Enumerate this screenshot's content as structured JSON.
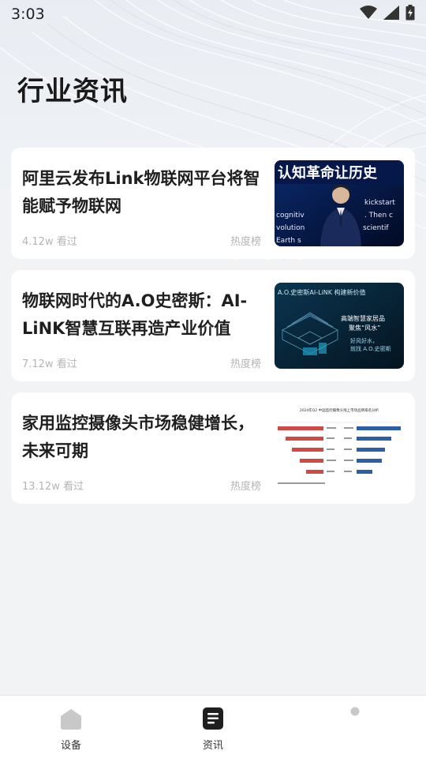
{
  "status_bar": {
    "time": "3:03",
    "icons": [
      "wifi-icon",
      "signal-icon",
      "battery-charging-icon"
    ]
  },
  "page": {
    "title": "行业资讯"
  },
  "news": [
    {
      "title": "阿里云发布Link物联网平台将智能赋予物联网",
      "views": "4.12w 看过",
      "tag": "热度榜",
      "thumb_text": [
        "认知革命让历史",
        "kickstart",
        "cognitiv",
        "volution",
        ". Then c",
        "Earth s",
        "scientif"
      ]
    },
    {
      "title": "物联网时代的A.O史密斯：AI-LiNK智慧互联再造产业价值",
      "views": "7.12w 看过",
      "tag": "热度榜",
      "thumb_text": [
        "A.O.史密斯AI-LiNK 构建新价值",
        "高端智慧家居品",
        "聚焦“风水”",
        "好风好水，",
        "就找 A.O.史密斯"
      ]
    },
    {
      "title": "家用监控摄像头市场稳健增长，未来可期",
      "views": "13.12w 看过",
      "tag": "热度榜",
      "thumb_text": [
        "2024年Q2 中国监控摄像头线上市场品牌排名分析"
      ]
    }
  ],
  "bottom_nav": {
    "items": [
      {
        "label": "设备",
        "icon": "home-icon",
        "active": false
      },
      {
        "label": "资讯",
        "icon": "document-icon",
        "active": true
      },
      {
        "label": "",
        "icon": "dot-icon",
        "active": false
      }
    ]
  },
  "colors": {
    "background": "#f2f3f5",
    "card": "#ffffff",
    "muted_text": "#b5b5b5",
    "active_icon": "#1f1f1f",
    "inactive_icon": "#c8c8c8"
  }
}
